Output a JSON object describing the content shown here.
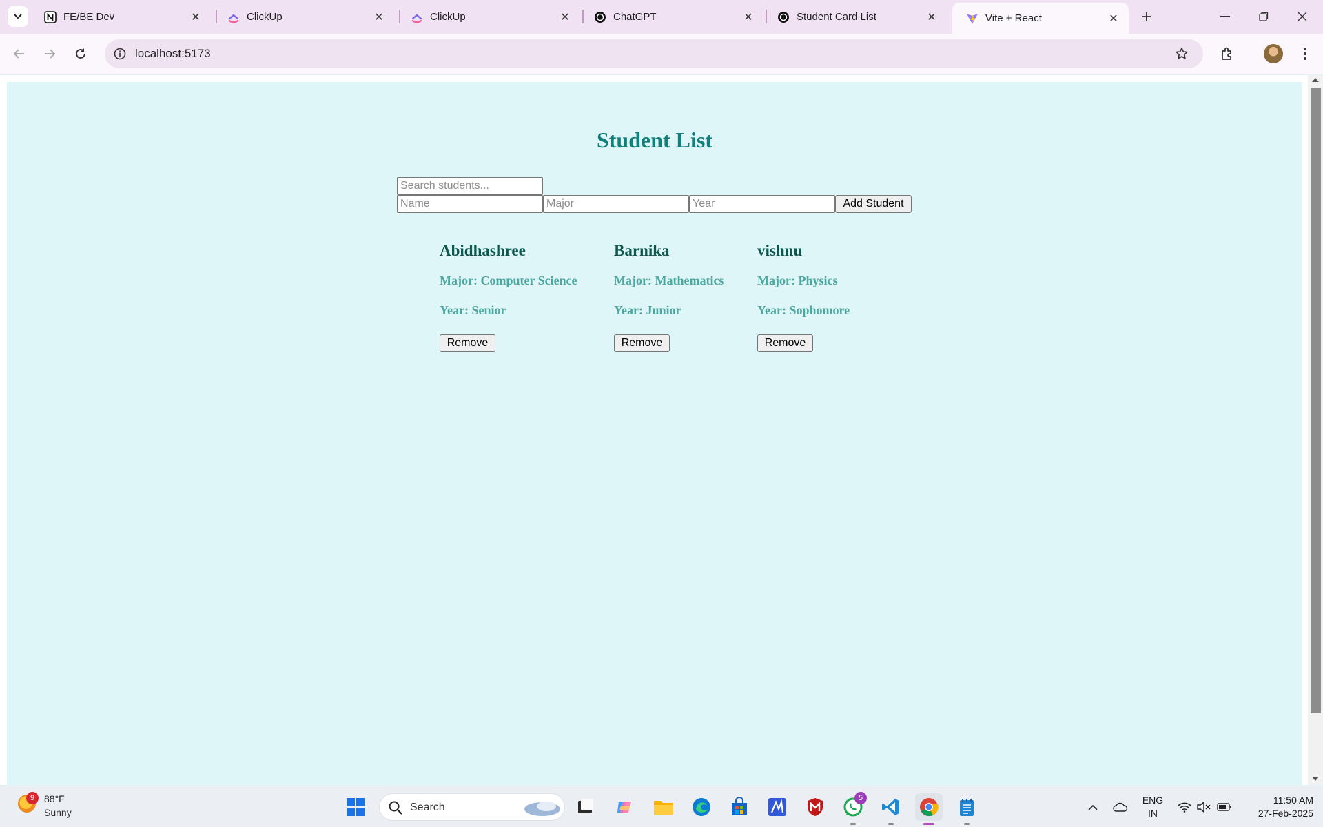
{
  "browser": {
    "tabs": [
      {
        "title": "FE/BE Dev",
        "icon": "notion-icon",
        "active": false
      },
      {
        "title": "ClickUp",
        "icon": "clickup-icon",
        "active": false
      },
      {
        "title": "ClickUp",
        "icon": "clickup-icon",
        "active": false
      },
      {
        "title": "ChatGPT",
        "icon": "chatgpt-icon",
        "active": false
      },
      {
        "title": "Student Card List",
        "icon": "chatgpt-icon",
        "active": false
      },
      {
        "title": "Vite + React",
        "icon": "vite-icon",
        "active": true
      }
    ],
    "url": "localhost:5173"
  },
  "page": {
    "title": "Student List",
    "search": {
      "placeholder": "Search students...",
      "value": ""
    },
    "form": {
      "name_placeholder": "Name",
      "major_placeholder": "Major",
      "year_placeholder": "Year",
      "add_label": "Add Student"
    },
    "students": [
      {
        "name": "Abidhashree",
        "major": "Major: Computer Science",
        "year": "Year: Senior",
        "remove_label": "Remove"
      },
      {
        "name": "Barnika",
        "major": "Major: Mathematics",
        "year": "Year: Junior",
        "remove_label": "Remove"
      },
      {
        "name": "vishnu",
        "major": "Major: Physics",
        "year": "Year: Sophomore",
        "remove_label": "Remove"
      }
    ]
  },
  "taskbar": {
    "weather": {
      "temp": "88°F",
      "desc": "Sunny",
      "badge": "9"
    },
    "search_label": "Search",
    "whatsapp_badge": "5",
    "language": {
      "line1": "ENG",
      "line2": "IN"
    },
    "clock": {
      "time": "11:50 AM",
      "date": "27-Feb-2025"
    }
  },
  "colors": {
    "page_bg": "#def6f7",
    "title": "#127f7b",
    "student_name": "#0e574f",
    "student_meta": "#4aa8a0",
    "tab_strip": "#f1e2f3"
  }
}
